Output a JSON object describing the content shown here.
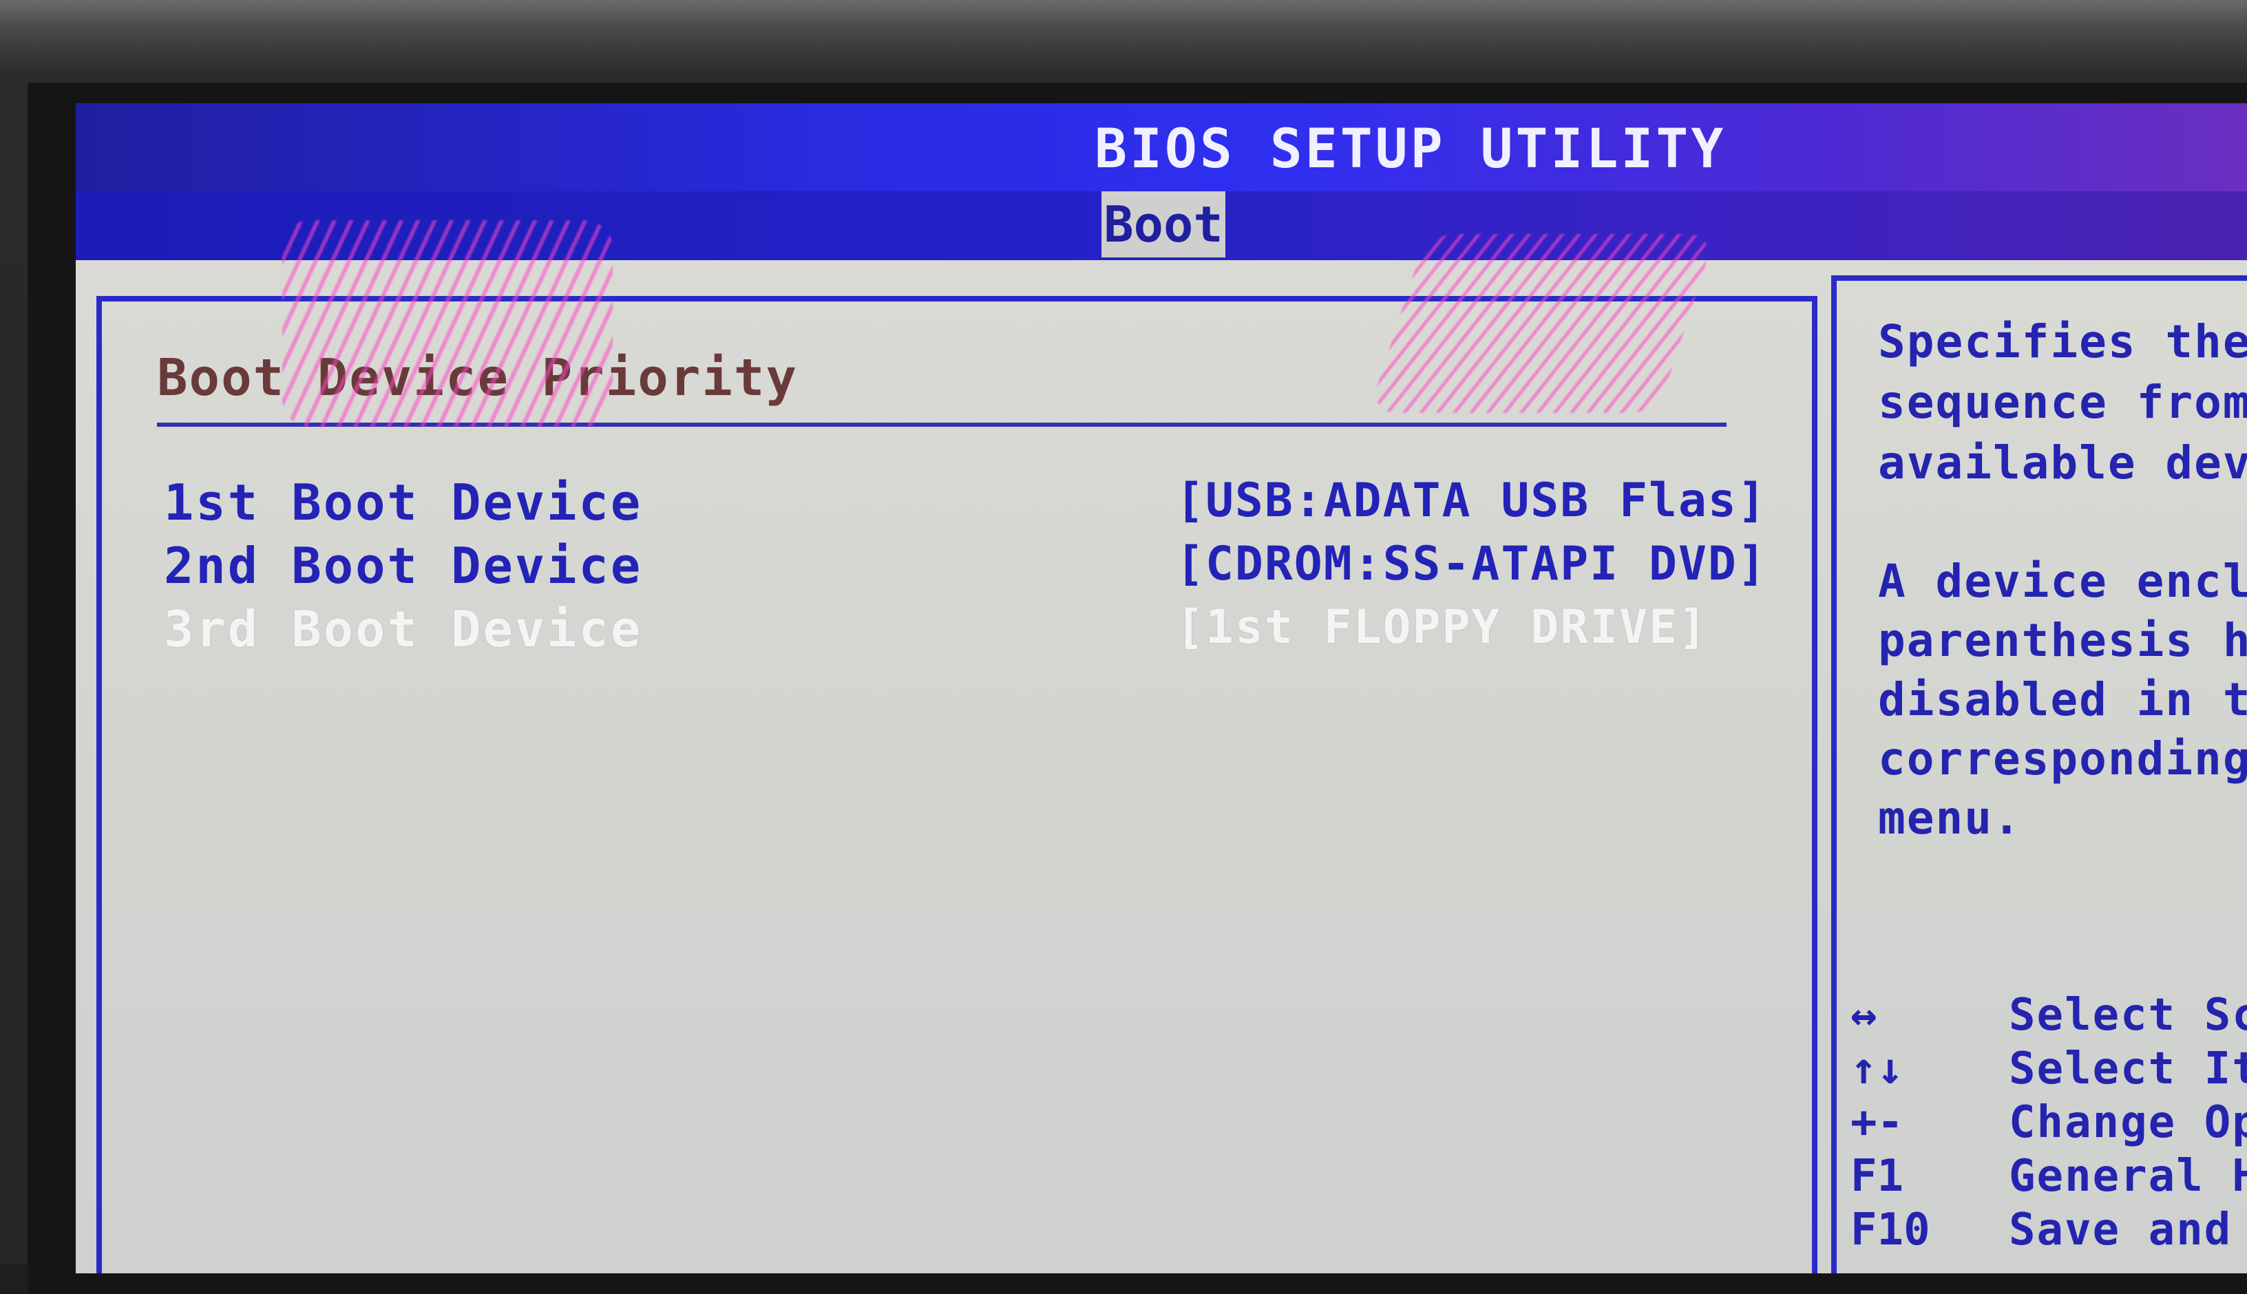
{
  "header": {
    "title": "BIOS SETUP UTILITY",
    "active_tab": "Boot"
  },
  "main": {
    "section_title": "Boot Device Priority",
    "boot_devices": [
      {
        "label": "1st Boot Device",
        "value": "[USB:ADATA USB Flas]"
      },
      {
        "label": "2nd Boot Device",
        "value": "[CDROM:SS-ATAPI DVD]"
      },
      {
        "label": "3rd Boot Device",
        "value": "[1st FLOPPY DRIVE]"
      }
    ]
  },
  "help": {
    "lines": [
      "Specifies the",
      "sequence from",
      "available devi",
      "A device enclo",
      "parenthesis ha",
      "disabled in th",
      "corresponding",
      "menu."
    ]
  },
  "keys": [
    {
      "key": "↔",
      "desc": "Select Scr"
    },
    {
      "key": "↑↓",
      "desc": "Select Ite"
    },
    {
      "key": "+-",
      "desc": "Change Opt"
    },
    {
      "key": "F1",
      "desc": "General He"
    },
    {
      "key": "F10",
      "desc": "Save and Ex"
    }
  ],
  "colors": {
    "title_bar": "#2a2ae0",
    "panel_border": "#2a2ac8",
    "screen_bg": "#d6d6d2",
    "active_text": "#2323b8",
    "highlight_text": "#f4f4f4",
    "section_title": "#6a3a3a"
  }
}
